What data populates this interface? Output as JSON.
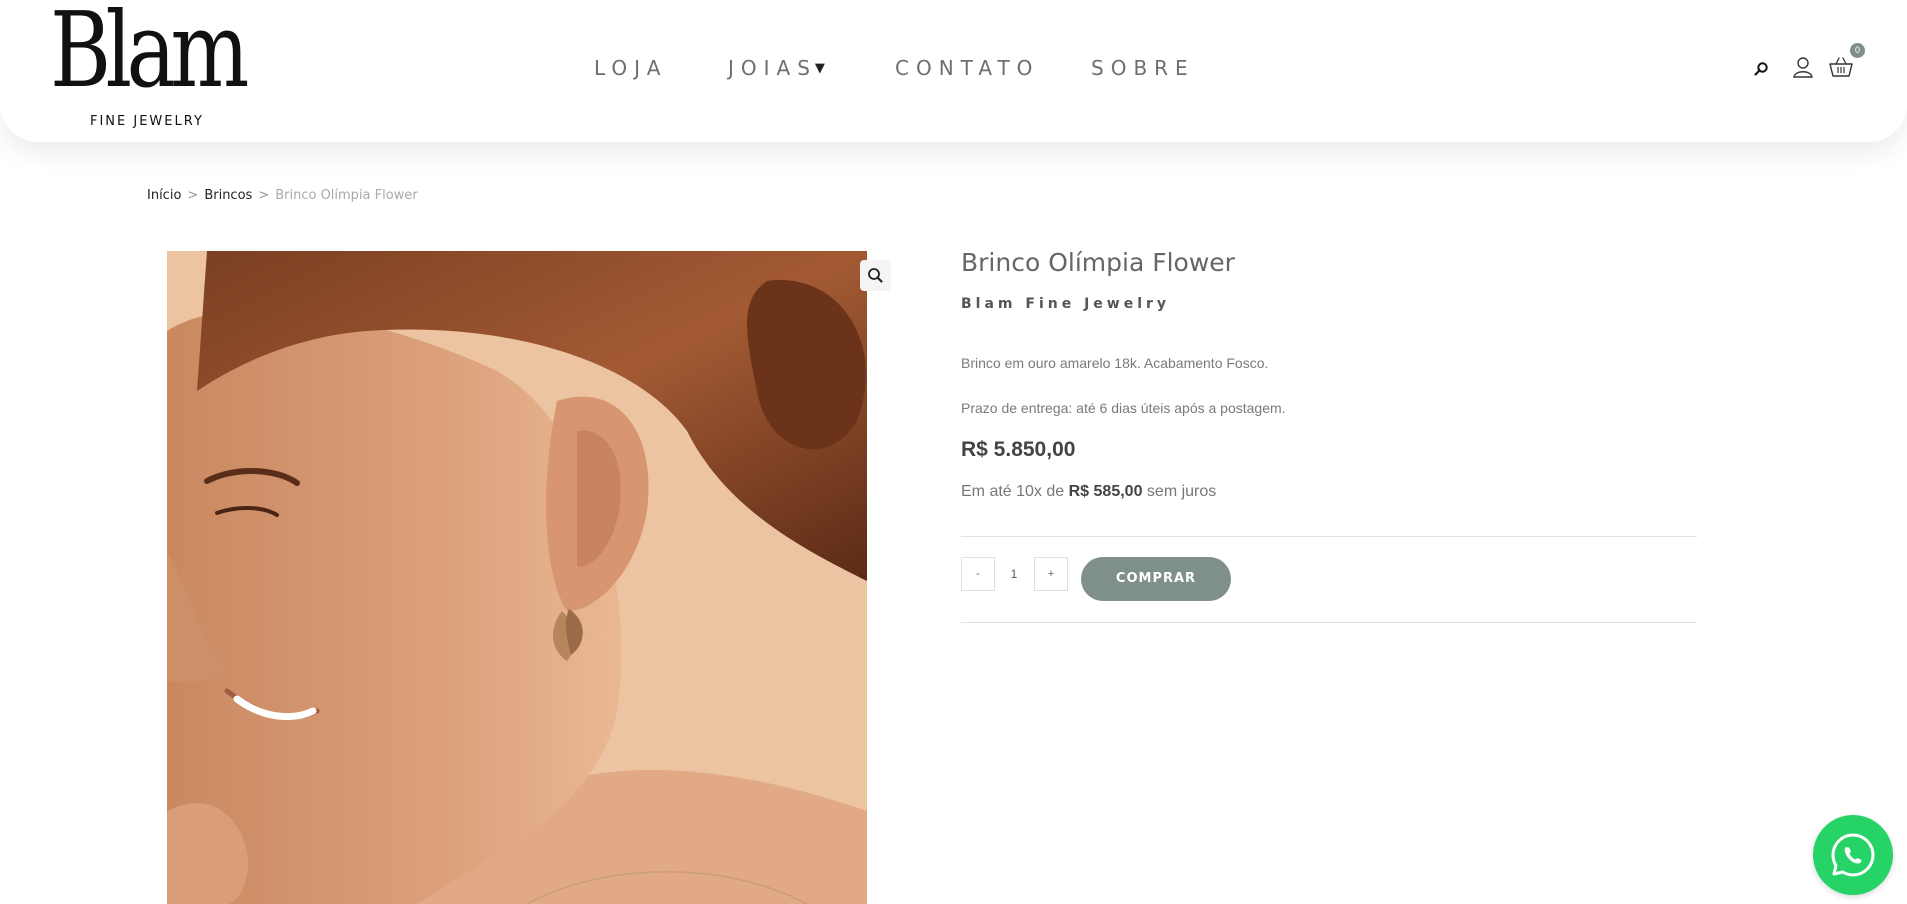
{
  "header": {
    "logo_text": "Blam",
    "logo_subtitle": "FINE JEWELRY",
    "nav": [
      {
        "label": "LOJA"
      },
      {
        "label": "JOIAS",
        "has_dropdown": true
      },
      {
        "label": "CONTATO"
      },
      {
        "label": "SOBRE"
      }
    ],
    "icons": [
      "search-icon",
      "user-icon",
      "cart-icon"
    ],
    "cart_count": "0",
    "cart_badge_color": "#7f9088"
  },
  "breadcrumb": {
    "items": [
      "Início",
      "Brincos"
    ],
    "separator": ">",
    "current": "Brinco Olímpia Flower"
  },
  "product": {
    "title": "Brinco Olímpia Flower",
    "brand": "Blam Fine Jewelry",
    "description": "Brinco em ouro amarelo 18k. Acabamento Fosco.",
    "delivery": "Prazo de entrega: até 6 dias úteis após a postagem.",
    "price": "R$ 5.850,00",
    "installments": {
      "prefix": "Em até 10x de",
      "amount": "R$ 585,00",
      "suffix": "sem juros"
    },
    "quantity": {
      "minus_label": "-",
      "value": "1",
      "plus_label": "+"
    },
    "buy_label": "COMPRAR",
    "buy_color": "#7f9088"
  },
  "whatsapp": {
    "icon": "whatsapp-icon",
    "color": "#25d366"
  }
}
